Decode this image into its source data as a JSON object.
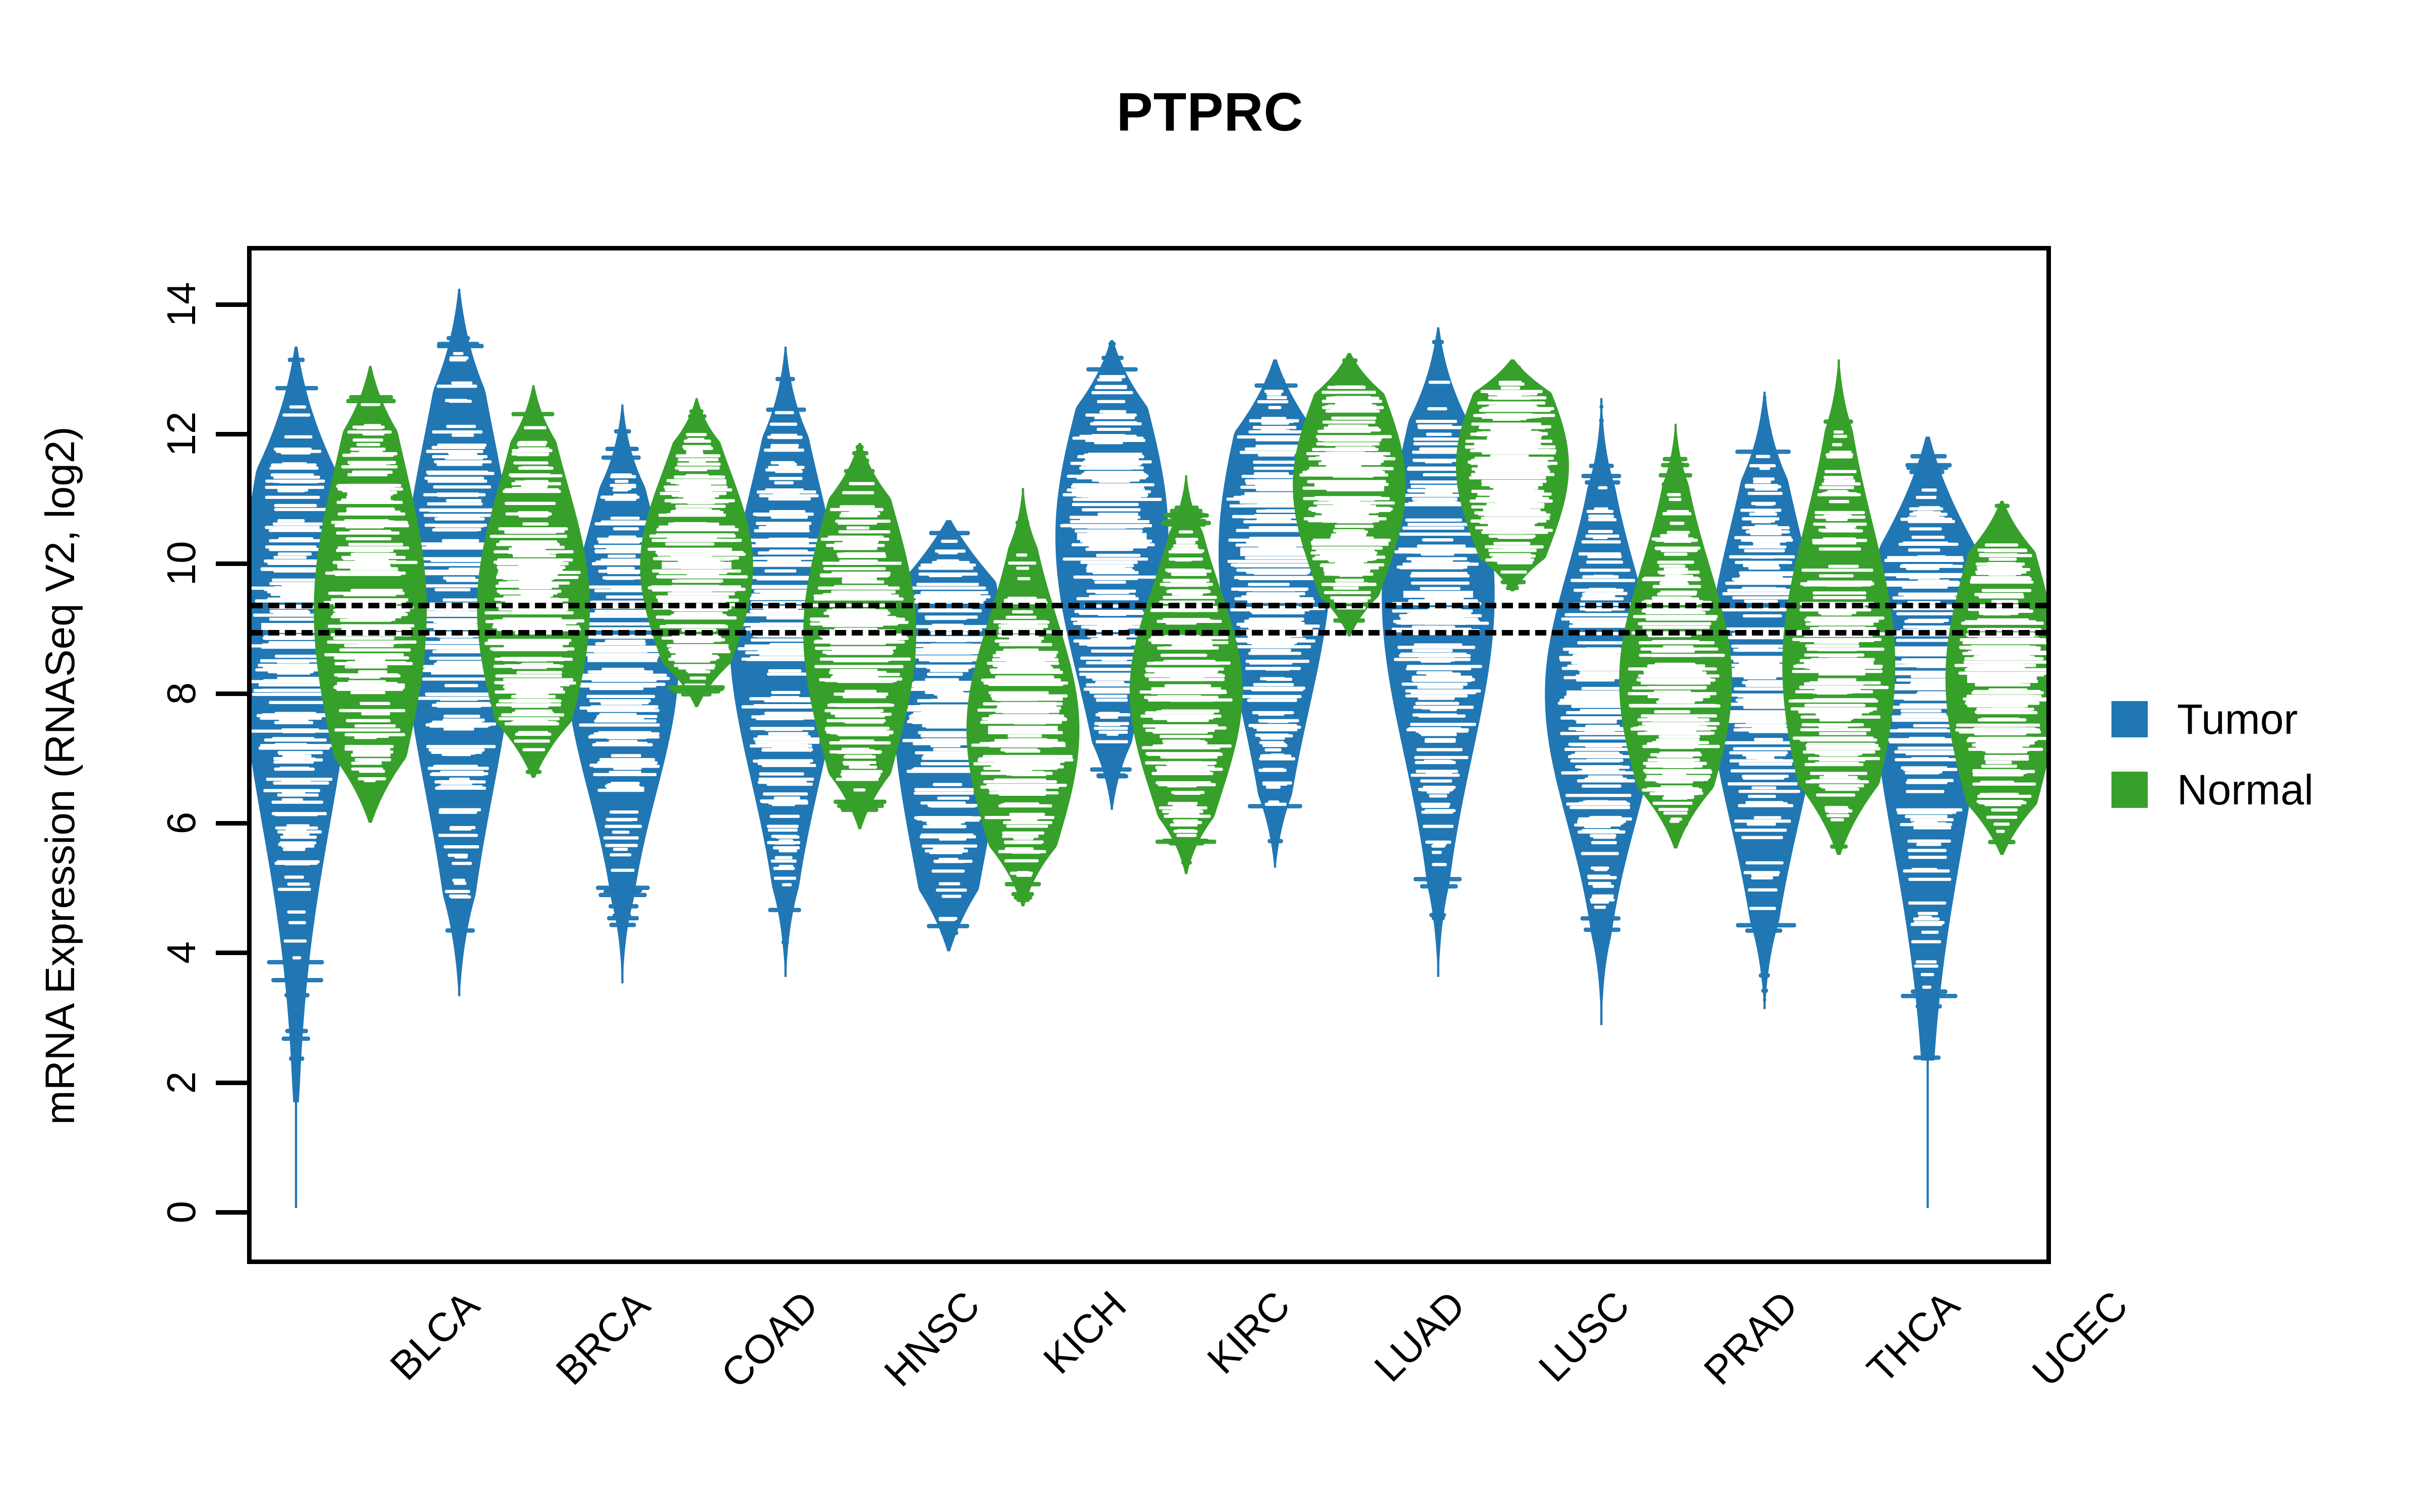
{
  "title": "PTPRC",
  "axes": {
    "ylabel": "mRNA Expression (RNASeq V2, log2)",
    "xlabel": "",
    "yticks": [
      "0",
      "2",
      "4",
      "6",
      "8",
      "10",
      "12",
      "14"
    ]
  },
  "legend": {
    "items": [
      {
        "label": "Tumor",
        "color": "#2077b4"
      },
      {
        "label": "Normal",
        "color": "#36a02b"
      }
    ]
  },
  "colors": {
    "tumor": "#2077b4",
    "normal": "#36a02b",
    "axis": "#000000",
    "background": "#ffffff"
  },
  "chart_data": {
    "type": "violin",
    "title": "PTPRC",
    "xlabel": "",
    "ylabel": "mRNA Expression (RNASeq V2, log2)",
    "ylim": [
      -0.8,
      14.9
    ],
    "ytick_values": [
      0,
      2,
      4,
      6,
      8,
      10,
      12,
      14
    ],
    "grid": false,
    "legend_position": "right",
    "reference_lines": [
      {
        "value": 9.47,
        "style": "dashed",
        "color": "#000000"
      },
      {
        "value": 9.05,
        "style": "dashed",
        "color": "#000000"
      }
    ],
    "categories": [
      "BLCA",
      "BRCA",
      "COAD",
      "HNSC",
      "KICH",
      "KIRC",
      "LUAD",
      "LUSC",
      "PRAD",
      "THCA",
      "UCEC"
    ],
    "series": [
      {
        "name": "Tumor",
        "color": "#2077b4",
        "groups": [
          {
            "category": "BLCA",
            "median": 9.05,
            "q1": 7.85,
            "q3": 10.05,
            "min": 0.0,
            "max": 13.4,
            "whisker_low": 1.65,
            "whisker_high": 13.4
          },
          {
            "category": "BRCA",
            "median": 9.35,
            "q1": 8.3,
            "q3": 10.35,
            "min": 3.3,
            "max": 14.3,
            "whisker_low": 3.3,
            "whisker_high": 14.3
          },
          {
            "category": "COAD",
            "median": 8.55,
            "q1": 8.0,
            "q3": 9.5,
            "min": 3.5,
            "max": 12.5,
            "whisker_low": 3.5,
            "whisker_high": 12.5
          },
          {
            "category": "HNSC",
            "median": 9.0,
            "q1": 8.3,
            "q3": 10.0,
            "min": 3.6,
            "max": 13.4,
            "whisker_low": 3.6,
            "whisker_high": 13.4
          },
          {
            "category": "KICH",
            "median": 8.15,
            "q1": 7.05,
            "q3": 9.1,
            "min": 4.0,
            "max": 10.7,
            "whisker_low": 4.0,
            "whisker_high": 10.7
          },
          {
            "category": "KIRC",
            "median": 10.45,
            "q1": 9.7,
            "q3": 11.3,
            "min": 6.2,
            "max": 13.5,
            "whisker_low": 6.2,
            "whisker_high": 13.5
          },
          {
            "category": "LUAD",
            "median": 10.2,
            "q1": 9.4,
            "q3": 11.15,
            "min": 5.3,
            "max": 13.2,
            "whisker_low": 5.3,
            "whisker_high": 13.2
          },
          {
            "category": "LUSC",
            "median": 9.55,
            "q1": 8.8,
            "q3": 10.6,
            "min": 3.6,
            "max": 13.7,
            "whisker_low": 3.6,
            "whisker_high": 13.7
          },
          {
            "category": "PRAD",
            "median": 8.0,
            "q1": 7.35,
            "q3": 8.8,
            "min": 2.85,
            "max": 12.6,
            "whisker_low": 2.85,
            "whisker_high": 12.6
          },
          {
            "category": "THCA",
            "median": 8.35,
            "q1": 7.55,
            "q3": 9.25,
            "min": 3.1,
            "max": 12.7,
            "whisker_low": 3.1,
            "whisker_high": 12.7
          },
          {
            "category": "UCEC",
            "median": 8.65,
            "q1": 7.35,
            "q3": 9.55,
            "min": 0.0,
            "max": 12.0,
            "whisker_low": 2.3,
            "whisker_high": 12.0
          }
        ]
      },
      {
        "name": "Normal",
        "color": "#36a02b",
        "groups": [
          {
            "category": "BLCA",
            "median": 9.3,
            "q1": 8.45,
            "q3": 10.2,
            "min": 6.0,
            "max": 13.1,
            "whisker_low": 6.0,
            "whisker_high": 13.1
          },
          {
            "category": "BRCA",
            "median": 9.35,
            "q1": 8.7,
            "q3": 10.15,
            "min": 6.7,
            "max": 12.8,
            "whisker_low": 6.7,
            "whisker_high": 12.8
          },
          {
            "category": "COAD",
            "median": 10.0,
            "q1": 9.45,
            "q3": 10.55,
            "min": 7.8,
            "max": 12.6,
            "whisker_low": 7.8,
            "whisker_high": 12.6
          },
          {
            "category": "HNSC",
            "median": 8.95,
            "q1": 8.25,
            "q3": 9.7,
            "min": 5.9,
            "max": 11.9,
            "whisker_low": 5.9,
            "whisker_high": 11.9
          },
          {
            "category": "KICH",
            "median": 7.45,
            "q1": 6.85,
            "q3": 8.15,
            "min": 4.7,
            "max": 11.2,
            "whisker_low": 4.7,
            "whisker_high": 11.2
          },
          {
            "category": "KIRC",
            "median": 8.05,
            "q1": 7.5,
            "q3": 8.7,
            "min": 5.2,
            "max": 11.4,
            "whisker_low": 5.2,
            "whisker_high": 11.4
          },
          {
            "category": "LUAD",
            "median": 11.25,
            "q1": 10.8,
            "q3": 11.9,
            "min": 8.9,
            "max": 13.3,
            "whisker_low": 8.9,
            "whisker_high": 13.3
          },
          {
            "category": "LUSC",
            "median": 11.55,
            "q1": 11.05,
            "q3": 12.05,
            "min": 9.6,
            "max": 13.2,
            "whisker_low": 9.6,
            "whisker_high": 13.2
          },
          {
            "category": "PRAD",
            "median": 8.2,
            "q1": 7.6,
            "q3": 8.95,
            "min": 5.6,
            "max": 12.2,
            "whisker_low": 5.6,
            "whisker_high": 12.2
          },
          {
            "category": "THCA",
            "median": 8.45,
            "q1": 7.65,
            "q3": 9.3,
            "min": 5.5,
            "max": 13.2,
            "whisker_low": 5.5,
            "whisker_high": 13.2
          },
          {
            "category": "UCEC",
            "median": 8.25,
            "q1": 7.6,
            "q3": 9.05,
            "min": 5.5,
            "max": 11.0,
            "whisker_low": 5.5,
            "whisker_high": 11.0
          }
        ]
      }
    ]
  }
}
